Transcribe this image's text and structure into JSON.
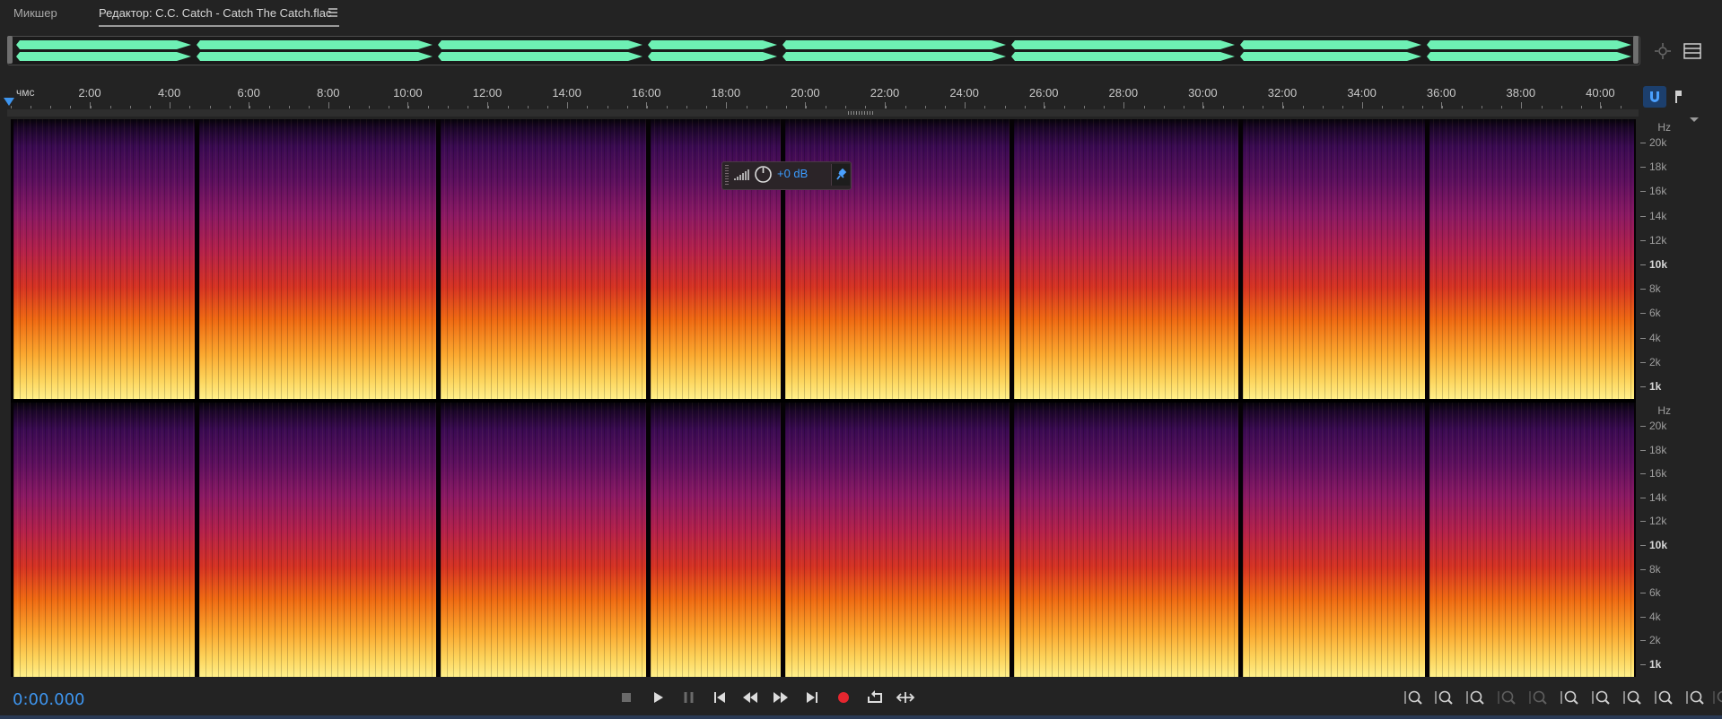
{
  "tabs": {
    "mixer": "Микшер",
    "editor": "Редактор: C.C. Catch - Catch The Catch.flac"
  },
  "ruler": {
    "unit": "чмс",
    "ticks": [
      "2:00",
      "4:00",
      "6:00",
      "8:00",
      "10:00",
      "12:00",
      "14:00",
      "16:00",
      "18:00",
      "20:00",
      "22:00",
      "24:00",
      "26:00",
      "28:00",
      "30:00",
      "32:00",
      "34:00",
      "36:00",
      "38:00",
      "40:00"
    ]
  },
  "freq_axis": {
    "unit": "Hz",
    "labels": [
      {
        "text": "20k",
        "bold": false
      },
      {
        "text": "18k",
        "bold": false
      },
      {
        "text": "16k",
        "bold": false
      },
      {
        "text": "14k",
        "bold": false
      },
      {
        "text": "12k",
        "bold": false
      },
      {
        "text": "10k",
        "bold": true
      },
      {
        "text": "8k",
        "bold": false
      },
      {
        "text": "6k",
        "bold": false
      },
      {
        "text": "4k",
        "bold": false
      },
      {
        "text": "2k",
        "bold": false
      },
      {
        "text": "1k",
        "bold": true
      }
    ]
  },
  "hud": {
    "gain": "+0 dB"
  },
  "transport": {
    "timecode": "0:00.000"
  },
  "colors": {
    "waveform": "#6ef0b4",
    "accent": "#3e95ee",
    "record": "#e5262f"
  },
  "icons": {
    "transport": [
      "stop-icon",
      "play-icon",
      "pause-icon",
      "skip-to-start-icon",
      "rewind-icon",
      "fast-forward-icon",
      "skip-to-end-icon",
      "record-icon",
      "loop-icon",
      "skip-selection-icon"
    ],
    "zoom": [
      "zoom-in-amplitude-icon",
      "zoom-out-amplitude-icon",
      "zoom-in-time-icon",
      "zoom-out-time-icon",
      "zoom-in-selection-icon",
      "zoom-out-full-icon",
      "zoom-selection-left-icon",
      "zoom-selection-right-icon",
      "zoom-to-selection-icon",
      "zoom-reset-icon",
      "zoom-tool-icon"
    ]
  }
}
